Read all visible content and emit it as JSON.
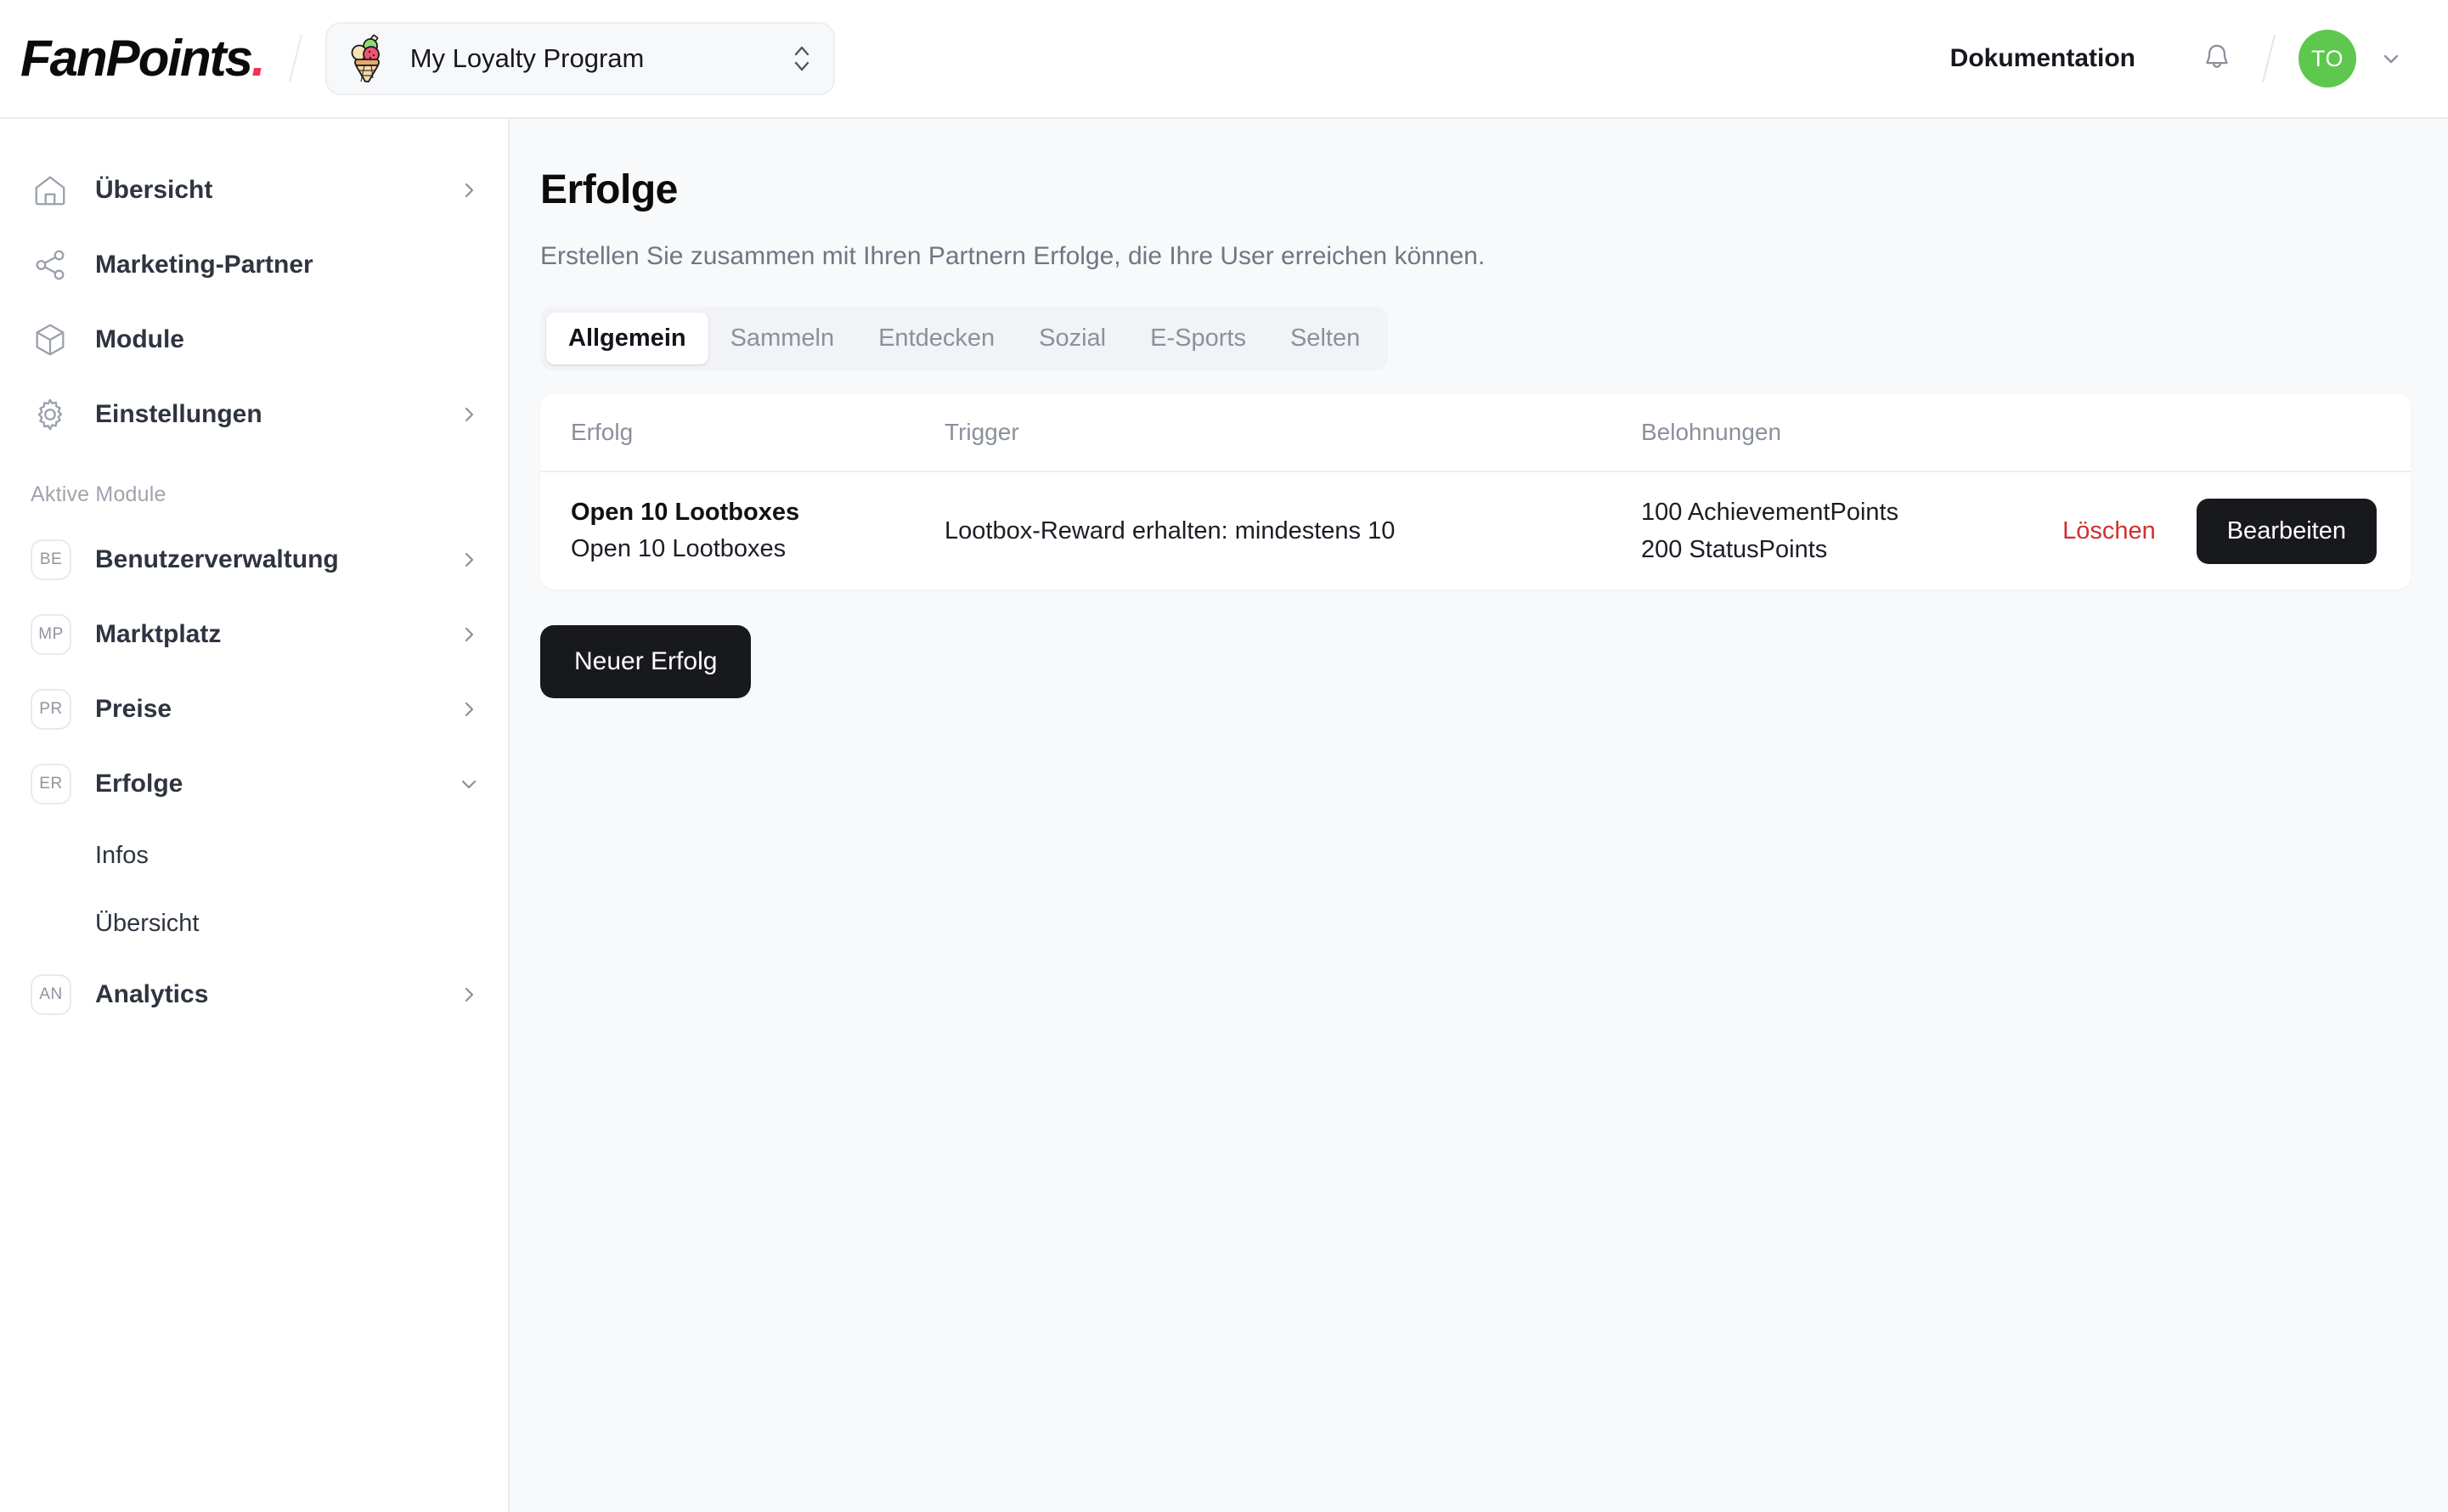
{
  "header": {
    "brand_name": "FanPoints",
    "brand_dot": ".",
    "program_selector": {
      "icon": "ice-cream-icon",
      "value": "My Loyalty Program",
      "chevron_icon": "chevron-up-down-icon"
    },
    "documentation_label": "Dokumentation",
    "notifications_icon": "bell-icon",
    "avatar_initials": "TO",
    "avatar_color": "#5ec74e",
    "account_chevron_icon": "chevron-down-icon"
  },
  "sidebar": {
    "main_items": [
      {
        "label": "Übersicht",
        "icon": "home-icon",
        "chevron": "chevron-right-icon",
        "has_chevron": true
      },
      {
        "label": "Marketing-Partner",
        "icon": "share-icon",
        "chevron": "",
        "has_chevron": false
      },
      {
        "label": "Module",
        "icon": "cube-icon",
        "chevron": "",
        "has_chevron": false
      },
      {
        "label": "Einstellungen",
        "icon": "gear-icon",
        "chevron": "chevron-right-icon",
        "has_chevron": true
      }
    ],
    "section_title": "Aktive Module",
    "modules": [
      {
        "badge": "BE",
        "label": "Benutzerverwaltung",
        "chevron_icon": "chevron-right-icon",
        "expanded": false
      },
      {
        "badge": "MP",
        "label": "Marktplatz",
        "chevron_icon": "chevron-right-icon",
        "expanded": false
      },
      {
        "badge": "PR",
        "label": "Preise",
        "chevron_icon": "chevron-right-icon",
        "expanded": false
      },
      {
        "badge": "ER",
        "label": "Erfolge",
        "chevron_icon": "chevron-down-icon",
        "expanded": true
      },
      {
        "badge": "AN",
        "label": "Analytics",
        "chevron_icon": "chevron-right-icon",
        "expanded": false
      }
    ],
    "erfolge_subitems": [
      {
        "label": "Infos"
      },
      {
        "label": "Übersicht"
      }
    ]
  },
  "main": {
    "page_title": "Erfolge",
    "page_subtitle": "Erstellen Sie zusammen mit Ihren Partnern Erfolge, die Ihre User erreichen können.",
    "tabs": [
      {
        "label": "Allgemein",
        "active": true
      },
      {
        "label": "Sammeln",
        "active": false
      },
      {
        "label": "Entdecken",
        "active": false
      },
      {
        "label": "Sozial",
        "active": false
      },
      {
        "label": "E-Sports",
        "active": false
      },
      {
        "label": "Selten",
        "active": false
      }
    ],
    "table": {
      "columns": [
        "Erfolg",
        "Trigger",
        "Belohnungen"
      ],
      "rows": [
        {
          "title": "Open 10 Lootboxes",
          "description": "Open 10 Lootboxes",
          "trigger": "Lootbox-Reward erhalten: mindestens 10",
          "rewards": [
            "100 AchievementPoints",
            "200 StatusPoints"
          ],
          "delete_label": "Löschen",
          "edit_label": "Bearbeiten"
        }
      ]
    },
    "new_button_label": "Neuer Erfolg"
  },
  "colors": {
    "accent_red": "#ef3355",
    "danger": "#cf3030",
    "dark_button": "#18191c",
    "avatar_green": "#5ec74e",
    "page_background": "#f7f9fb"
  }
}
